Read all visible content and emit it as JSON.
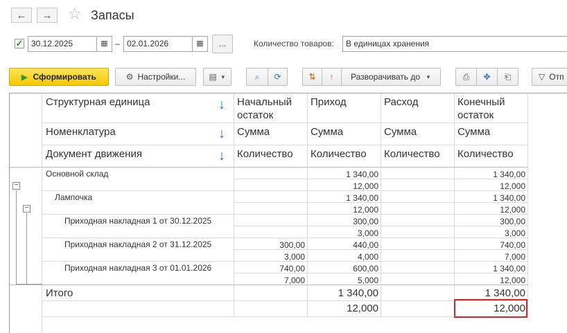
{
  "window": {
    "title": "Запасы",
    "back_icon": "←",
    "forward_icon": "→",
    "star_icon": "☆"
  },
  "filters": {
    "period_enabled": "✓",
    "date_from": "30.12.2025",
    "date_to": "02.01.2026",
    "separator": "–",
    "more_label": "...",
    "quantity_label": "Количество товаров:",
    "quantity_value": "В единицах хранения"
  },
  "toolbar": {
    "generate_label": "Сформировать",
    "settings_label": "Настройки...",
    "expand_label": "Разворачивать до",
    "output_label": "Отп"
  },
  "report": {
    "header": {
      "dim1": "Структурная единица",
      "dim2": "Номенклатура",
      "dim3": "Документ движения",
      "col_opening_1": "Начальный",
      "col_opening_2": "остаток",
      "col_income": "Приход",
      "col_expense": "Расход",
      "col_closing_1": "Конечный",
      "col_closing_2": "остаток",
      "sum": "Сумма",
      "quantity": "Количество"
    },
    "rows": [
      {
        "label": "Основной склад",
        "opening": "",
        "income": "1 340,00",
        "expense": "",
        "closing": "1 340,00"
      },
      {
        "label": "",
        "opening": "",
        "income": "12,000",
        "expense": "",
        "closing": "12,000"
      },
      {
        "label": "Лампочка",
        "opening": "",
        "income": "1 340,00",
        "expense": "",
        "closing": "1 340,00"
      },
      {
        "label": "",
        "opening": "",
        "income": "12,000",
        "expense": "",
        "closing": "12,000"
      },
      {
        "label": "Приходная накладная 1 от 30.12.2025",
        "opening": "",
        "income": "300,00",
        "expense": "",
        "closing": "300,00"
      },
      {
        "label": "",
        "opening": "",
        "income": "3,000",
        "expense": "",
        "closing": "3,000"
      },
      {
        "label": "Приходная накладная 2 от 31.12.2025",
        "opening": "300,00",
        "income": "440,00",
        "expense": "",
        "closing": "740,00"
      },
      {
        "label": "",
        "opening": "3,000",
        "income": "4,000",
        "expense": "",
        "closing": "7,000"
      },
      {
        "label": "Приходная накладная 3 от 01.01.2026",
        "opening": "740,00",
        "income": "600,00",
        "expense": "",
        "closing": "1 340,00"
      },
      {
        "label": "",
        "opening": "7,000",
        "income": "5,000",
        "expense": "",
        "closing": "12,000"
      }
    ],
    "total": {
      "label": "Итого",
      "sum_income": "1 340,00",
      "sum_closing": "1 340,00",
      "qty_income": "12,000",
      "qty_closing": "12,000"
    },
    "collapse_glyph": "−",
    "sort_glyph": "↓"
  },
  "highlight_color": "#e02020"
}
